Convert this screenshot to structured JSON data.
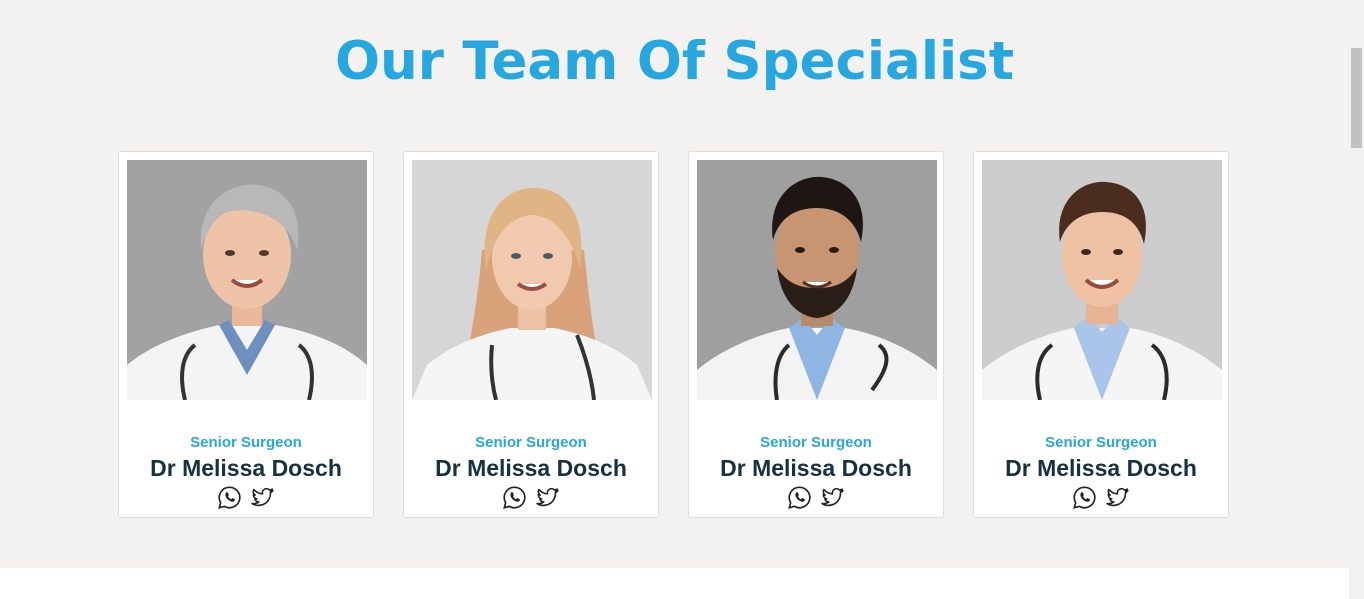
{
  "section": {
    "title": "Our Team Of Specialist"
  },
  "team": [
    {
      "role": "Senior Surgeon",
      "name": "Dr Melissa Dosch",
      "photo": "female-doctor-short-grey-hair"
    },
    {
      "role": "Senior Surgeon",
      "name": "Dr Melissa Dosch",
      "photo": "female-doctor-long-blonde-hair"
    },
    {
      "role": "Senior Surgeon",
      "name": "Dr Melissa Dosch",
      "photo": "male-doctor-beard"
    },
    {
      "role": "Senior Surgeon",
      "name": "Dr Melissa Dosch",
      "photo": "male-doctor-short-hair"
    }
  ],
  "social_icons": [
    "whatsapp-icon",
    "twitter-icon"
  ],
  "colors": {
    "accent": "#27a7e0",
    "name_text": "#17313f",
    "section_bg": "#f4f1f1",
    "card_bg": "#ffffff"
  }
}
